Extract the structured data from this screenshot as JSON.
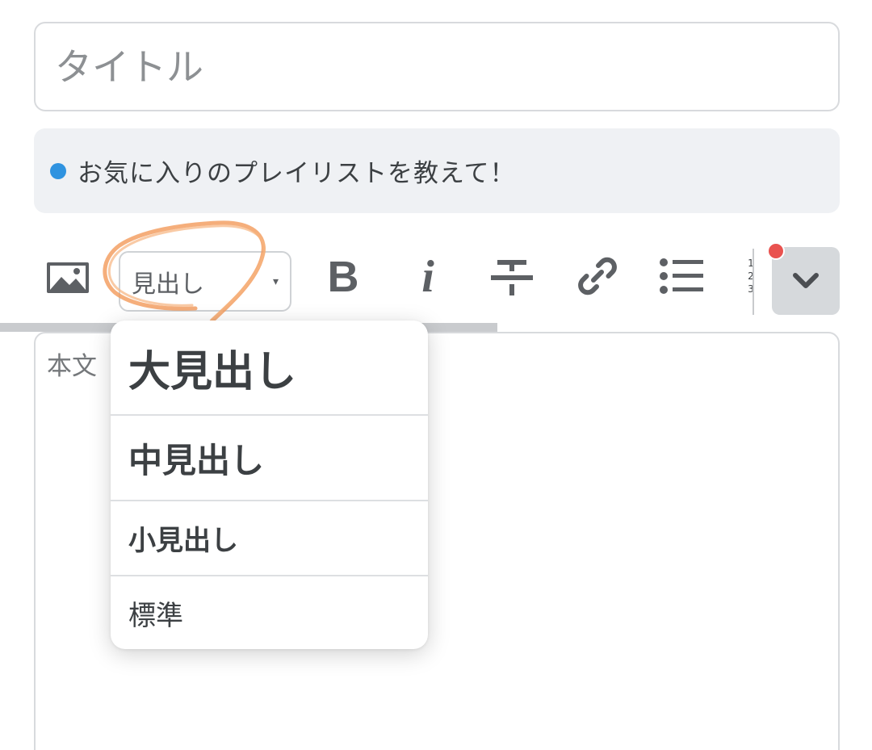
{
  "title_field": {
    "placeholder": "タイトル",
    "value": ""
  },
  "topic": {
    "text": "お気に入りのプレイリストを教えて！",
    "dot_color": "#2f93e0"
  },
  "toolbar": {
    "image_icon": "image-icon",
    "heading_select": {
      "label": "見出し",
      "arrow": "▾"
    },
    "bold_label": "B",
    "italic_label": "i",
    "strike_icon": "strikethrough-icon",
    "link_icon": "link-icon",
    "bullet_list_icon": "bullet-list-icon",
    "ordered_list_icon": "ordered-list-icon",
    "ordered_list_numbers": [
      "1",
      "2",
      "3"
    ],
    "more_icon": "chevron-down-icon",
    "notification_color": "#e9524f"
  },
  "heading_dropdown": {
    "items": [
      {
        "label": "大見出し"
      },
      {
        "label": "中見出し"
      },
      {
        "label": "小見出し"
      },
      {
        "label": "標準"
      }
    ]
  },
  "body": {
    "placeholder": "本文"
  },
  "annotation_color": "#f29a5a"
}
